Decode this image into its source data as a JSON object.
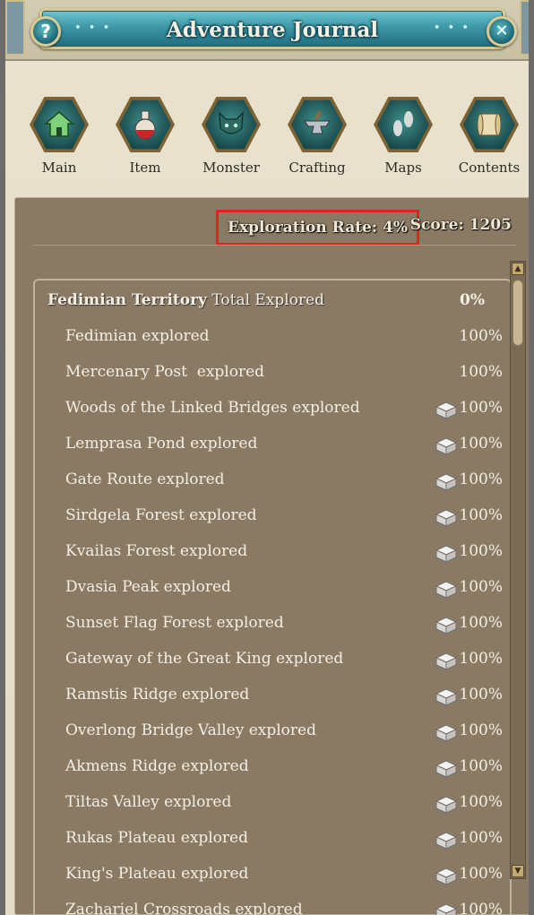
{
  "window": {
    "title": "Adventure Journal",
    "help_label": "?",
    "close_label": "✕",
    "title_decor": "• • •"
  },
  "nav": {
    "items": [
      {
        "label": "Main",
        "icon": "house-icon"
      },
      {
        "label": "Item",
        "icon": "potion-flask-icon"
      },
      {
        "label": "Monster",
        "icon": "monster-head-icon"
      },
      {
        "label": "Crafting",
        "icon": "anvil-icon"
      },
      {
        "label": "Maps",
        "icon": "footprints-icon"
      },
      {
        "label": "Contents",
        "icon": "scroll-icon"
      }
    ]
  },
  "stats": {
    "exploration_rate": "Exploration Rate: 4%",
    "score": "Score: 1205"
  },
  "territory": {
    "name": "Fedimian Territory",
    "suffix": " Total Explored",
    "percent": "0%"
  },
  "rows": [
    {
      "name": "Fedimian explored",
      "percent": "100%",
      "chest": false
    },
    {
      "name": "Mercenary Post  explored",
      "percent": "100%",
      "chest": false
    },
    {
      "name": "Woods of the Linked Bridges explored",
      "percent": "100%",
      "chest": true
    },
    {
      "name": "Lemprasa Pond explored",
      "percent": "100%",
      "chest": true
    },
    {
      "name": "Gate Route explored",
      "percent": "100%",
      "chest": true
    },
    {
      "name": "Sirdgela Forest explored",
      "percent": "100%",
      "chest": true
    },
    {
      "name": "Kvailas Forest explored",
      "percent": "100%",
      "chest": true
    },
    {
      "name": "Dvasia Peak explored",
      "percent": "100%",
      "chest": true
    },
    {
      "name": "Sunset Flag Forest explored",
      "percent": "100%",
      "chest": true
    },
    {
      "name": "Gateway of the Great King explored",
      "percent": "100%",
      "chest": true
    },
    {
      "name": "Ramstis Ridge explored",
      "percent": "100%",
      "chest": true
    },
    {
      "name": "Overlong Bridge Valley explored",
      "percent": "100%",
      "chest": true
    },
    {
      "name": "Akmens Ridge explored",
      "percent": "100%",
      "chest": true
    },
    {
      "name": "Tiltas Valley explored",
      "percent": "100%",
      "chest": true
    },
    {
      "name": "Rukas Plateau explored",
      "percent": "100%",
      "chest": true
    },
    {
      "name": "King's Plateau explored",
      "percent": "100%",
      "chest": true
    },
    {
      "name": "Zachariel Crossroads explored",
      "percent": "100%",
      "chest": true
    }
  ],
  "colors": {
    "highlight_box": "#e0231f",
    "panel_bg": "#8a7a64",
    "title_plate": "#3d98a7"
  }
}
